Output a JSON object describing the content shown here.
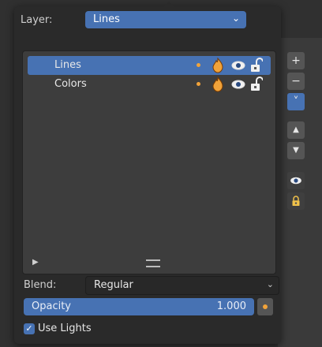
{
  "layer": {
    "label": "Layer:",
    "value": "Lines"
  },
  "layers": [
    {
      "name": "Lines",
      "selected": true
    },
    {
      "name": "Colors",
      "selected": false
    }
  ],
  "side_buttons": {
    "add": "+",
    "remove": "−",
    "dropdown": "˅",
    "move_up": "▲",
    "move_down": "▼"
  },
  "blend": {
    "label": "Blend:",
    "value": "Regular"
  },
  "opacity": {
    "label": "Opacity",
    "value": "1.000"
  },
  "use_lights": {
    "label": "Use Lights",
    "checked": true
  },
  "colors": {
    "accent": "#4772b3",
    "keyframe": "#f1a33a",
    "panel": "#2a2a2a",
    "list_bg": "#3d3d3d"
  }
}
